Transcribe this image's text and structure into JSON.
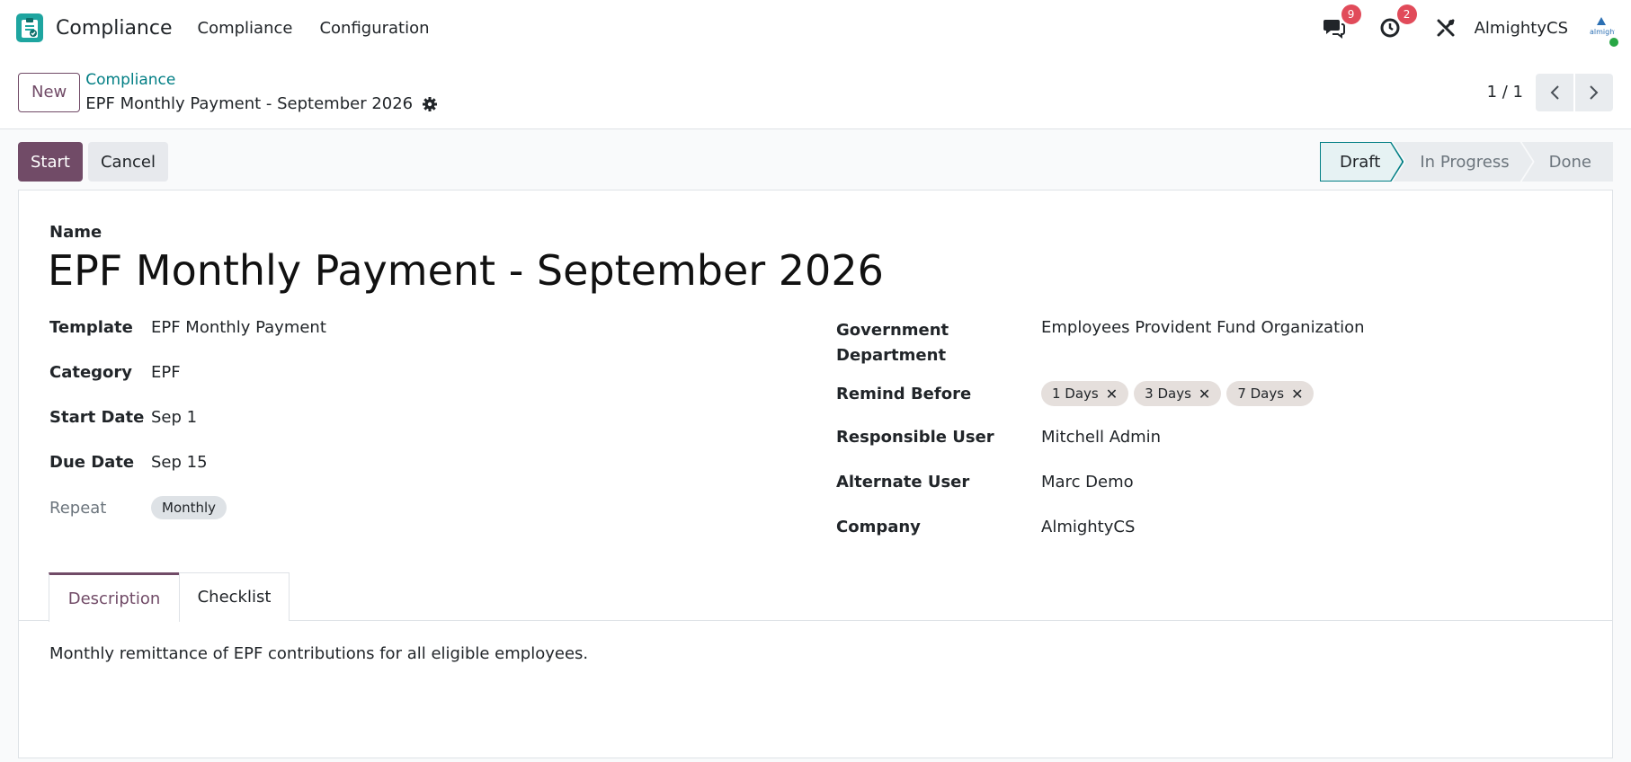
{
  "navbar": {
    "app_name": "Compliance",
    "menus": [
      "Compliance",
      "Configuration"
    ],
    "messages_count": "9",
    "activities_count": "2",
    "company": "AlmightyCS",
    "avatar_text": "almight"
  },
  "control_panel": {
    "new_label": "New",
    "breadcrumb_parent": "Compliance",
    "breadcrumb_current": "EPF Monthly Payment - September 2026",
    "pager": "1 / 1"
  },
  "statusbar": {
    "start_label": "Start",
    "cancel_label": "Cancel",
    "stages": [
      "Draft",
      "In Progress",
      "Done"
    ],
    "active_stage": "Draft"
  },
  "form": {
    "name_label": "Name",
    "title": "EPF Monthly Payment - September 2026",
    "left_fields": {
      "template_label": "Template",
      "template": "EPF Monthly Payment",
      "category_label": "Category",
      "category": "EPF",
      "start_date_label": "Start Date",
      "start_date": "Sep 1",
      "due_date_label": "Due Date",
      "due_date": "Sep 15",
      "repeat_label": "Repeat",
      "repeat": "Monthly"
    },
    "right_fields": {
      "gov_dept_label_1": "Government",
      "gov_dept_label_2": "Department",
      "gov_dept": "Employees Provident Fund Organization",
      "remind_label": "Remind Before",
      "remind_tags": [
        "1 Days",
        "3 Days",
        "7 Days"
      ],
      "responsible_label": "Responsible User",
      "responsible": "Mitchell Admin",
      "alternate_label": "Alternate User",
      "alternate": "Marc Demo",
      "company_label": "Company",
      "company": "AlmightyCS"
    },
    "tabs": [
      "Description",
      "Checklist"
    ],
    "active_tab": "Description",
    "description": "Monthly remittance of EPF contributions for all eligible employees."
  },
  "colors": {
    "brand": "#714b67",
    "link": "#017e84",
    "app_icon": "#1ea5a0",
    "badge": "#e14b5a"
  }
}
